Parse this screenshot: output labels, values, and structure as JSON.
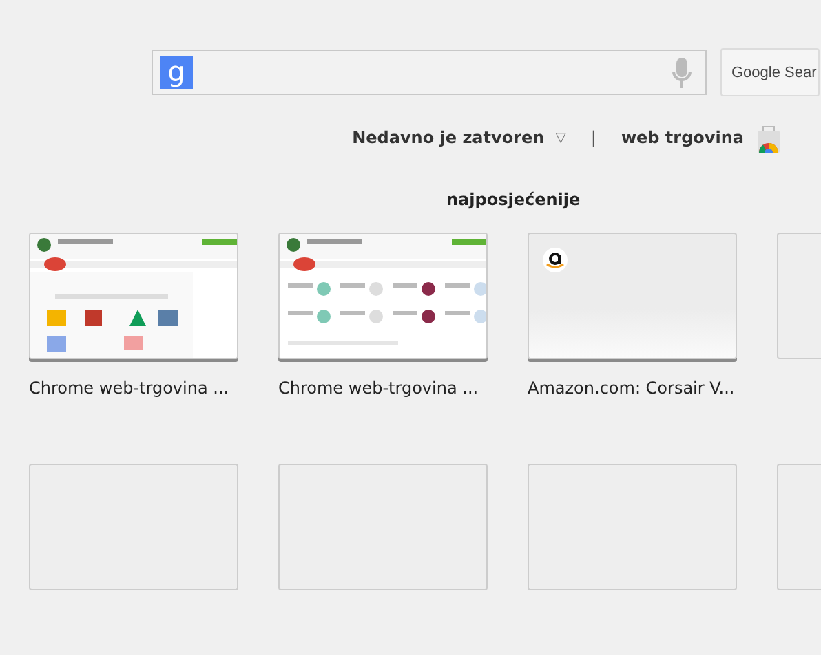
{
  "search": {
    "logo": "g",
    "button": "Google Sear"
  },
  "links": {
    "recently_closed": "Nedavno je zatvoren",
    "caret": "▽",
    "separator": "|",
    "web_store": "web trgovina"
  },
  "most_visited": {
    "title": "najposjećenije",
    "tiles": [
      {
        "kind": "thumbnail",
        "title": "Chrome web-trgovina ..."
      },
      {
        "kind": "thumbnail",
        "title": "Chrome web-trgovina ..."
      },
      {
        "kind": "favicon",
        "title": "Amazon.com: Corsair V..."
      },
      {
        "kind": "empty"
      },
      {
        "kind": "empty"
      },
      {
        "kind": "empty"
      },
      {
        "kind": "empty"
      },
      {
        "kind": "empty"
      }
    ]
  }
}
